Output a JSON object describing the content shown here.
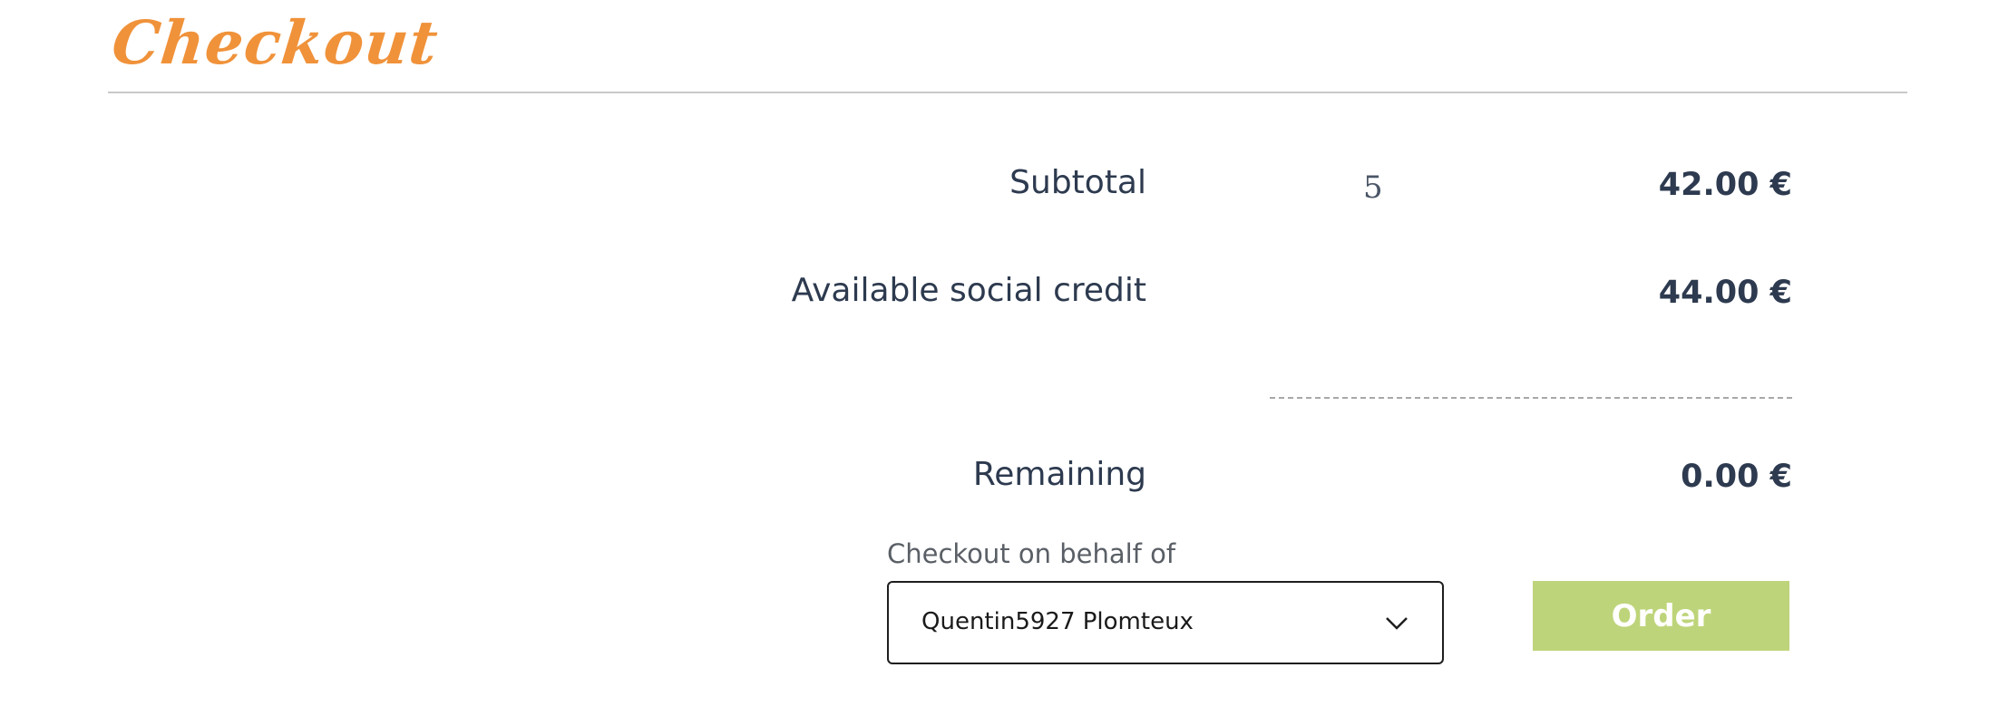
{
  "page": {
    "title": "Checkout"
  },
  "summary": {
    "subtotal_label": "Subtotal",
    "subtotal_quantity": "5",
    "subtotal_amount": "42.00 €",
    "credit_label": "Available social credit",
    "credit_amount": "44.00 €",
    "remaining_label": "Remaining",
    "remaining_amount": "0.00 €"
  },
  "checkout": {
    "behalf_label": "Checkout on behalf of",
    "behalf_selected": "Quentin5927 Plomteux",
    "order_label": "Order"
  },
  "colors": {
    "title": "#f0923a",
    "text": "#2d3a4f",
    "order_button": "#bed47a"
  }
}
